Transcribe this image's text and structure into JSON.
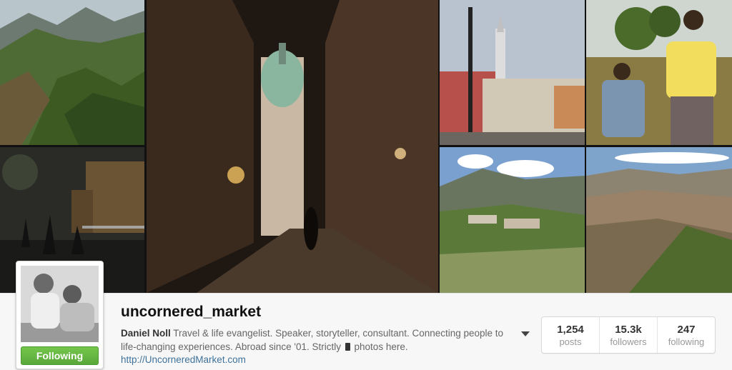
{
  "profile": {
    "username": "uncornered_market",
    "full_name": "Daniel Noll",
    "bio_part1": "Travel & life evangelist. Speaker, storyteller, consultant. Connecting people to life-changing experiences. Abroad since '01. Strictly",
    "bio_part2": "photos here.",
    "bio_icon": "mobile-phone-icon",
    "website": "http://UncorneredMarket.com",
    "follow_button_label": "Following",
    "options_icon": "chevron-down-icon"
  },
  "stats": [
    {
      "value": "1,254",
      "label": "posts"
    },
    {
      "value": "15.3k",
      "label": "followers"
    },
    {
      "value": "247",
      "label": "following"
    }
  ],
  "mosaic": [
    {
      "name": "mountain-valley-photo"
    },
    {
      "name": "fireworks-square-photo"
    },
    {
      "name": "night-street-tower-photo"
    },
    {
      "name": "town-square-clock-tower-photo"
    },
    {
      "name": "children-portrait-photo"
    },
    {
      "name": "green-hills-village-photo"
    },
    {
      "name": "mountain-ridges-photo"
    }
  ],
  "colors": {
    "accent_follow": "#6cbe45",
    "link": "#3f729b"
  }
}
